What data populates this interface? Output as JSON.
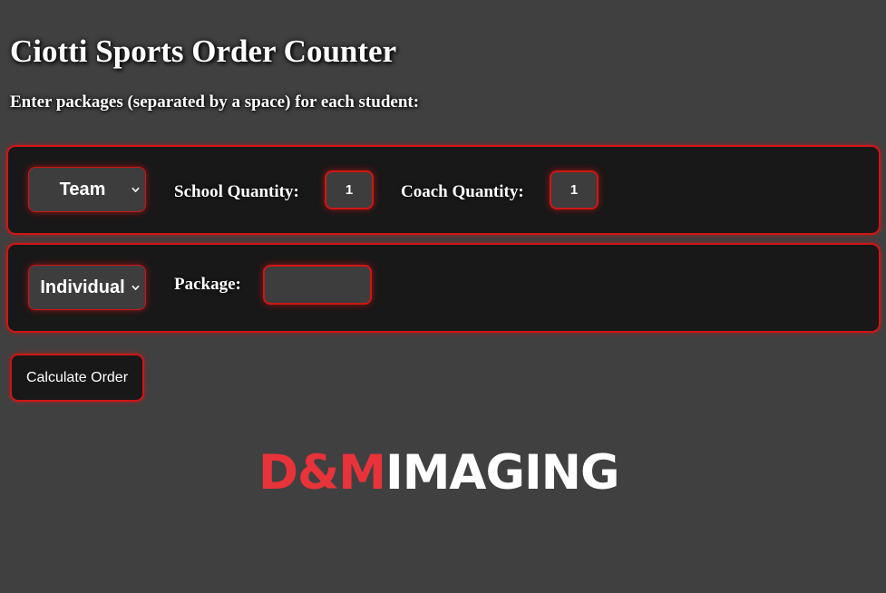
{
  "header": {
    "title": "Ciotti Sports Order Counter",
    "instructions": "Enter packages (separated by a space) for each student:"
  },
  "students": [
    {
      "type_selected": "Team",
      "school_quantity_label": "School Quantity:",
      "school_quantity_value": "1",
      "coach_quantity_label": "Coach Quantity:",
      "coach_quantity_value": "1"
    },
    {
      "type_selected": "Individual",
      "package_label": "Package:",
      "package_value": ""
    }
  ],
  "actions": {
    "calculate_label": "Calculate Order"
  },
  "brand": {
    "logo_part1": "D&M",
    "logo_part2": "IMAGING",
    "accent_color": "#e8333a"
  },
  "colors": {
    "background": "#404040",
    "panel": "#181818",
    "border_accent": "#d01515"
  },
  "icons": {
    "select_chevron": "chevron-down-icon"
  }
}
